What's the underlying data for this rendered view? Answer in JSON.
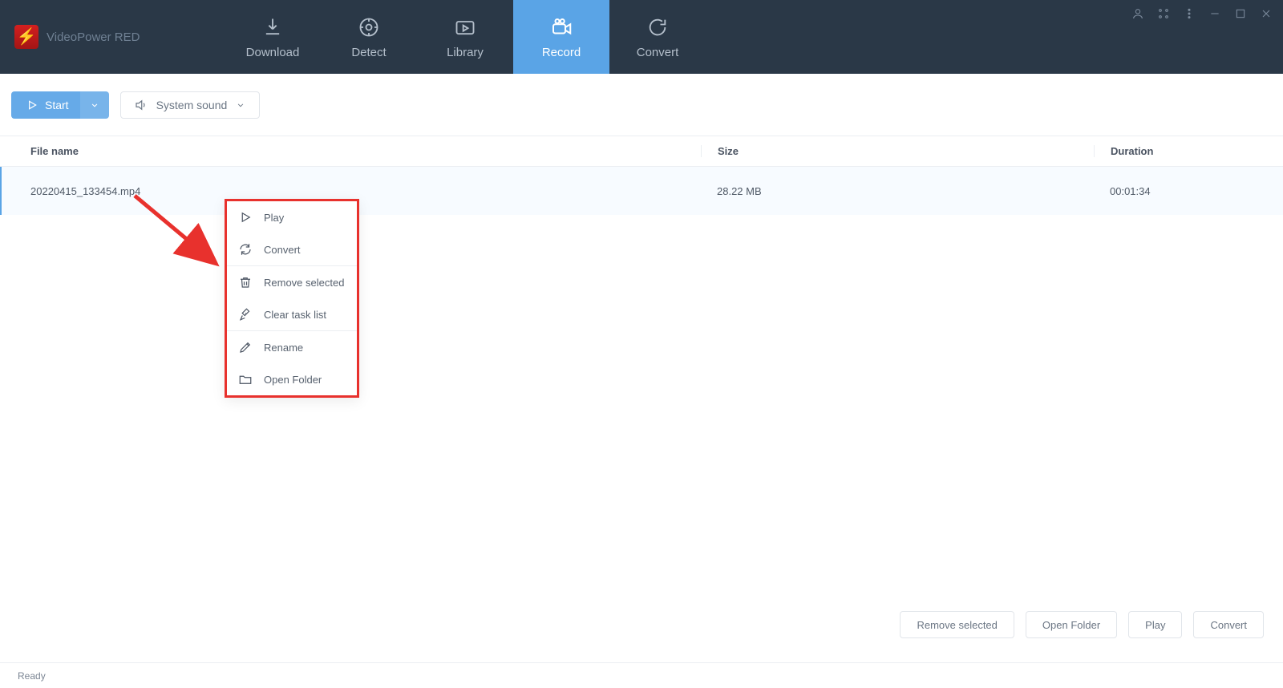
{
  "brand": {
    "name": "VideoPower RED"
  },
  "nav": {
    "tabs": [
      {
        "label": "Download",
        "active": false
      },
      {
        "label": "Detect",
        "active": false
      },
      {
        "label": "Library",
        "active": false
      },
      {
        "label": "Record",
        "active": true
      },
      {
        "label": "Convert",
        "active": false
      }
    ]
  },
  "toolbar": {
    "start_label": "Start",
    "sound_label": "System sound"
  },
  "table": {
    "headers": {
      "name": "File name",
      "size": "Size",
      "duration": "Duration"
    },
    "rows": [
      {
        "name": "20220415_133454.mp4",
        "size": "28.22 MB",
        "duration": "00:01:34"
      }
    ]
  },
  "context_menu": {
    "items": [
      {
        "label": "Play"
      },
      {
        "label": "Convert"
      },
      {
        "label": "Remove selected"
      },
      {
        "label": "Clear task list"
      },
      {
        "label": "Rename"
      },
      {
        "label": "Open Folder"
      }
    ]
  },
  "footer_buttons": {
    "remove": "Remove selected",
    "open": "Open Folder",
    "play": "Play",
    "convert": "Convert"
  },
  "status": "Ready"
}
